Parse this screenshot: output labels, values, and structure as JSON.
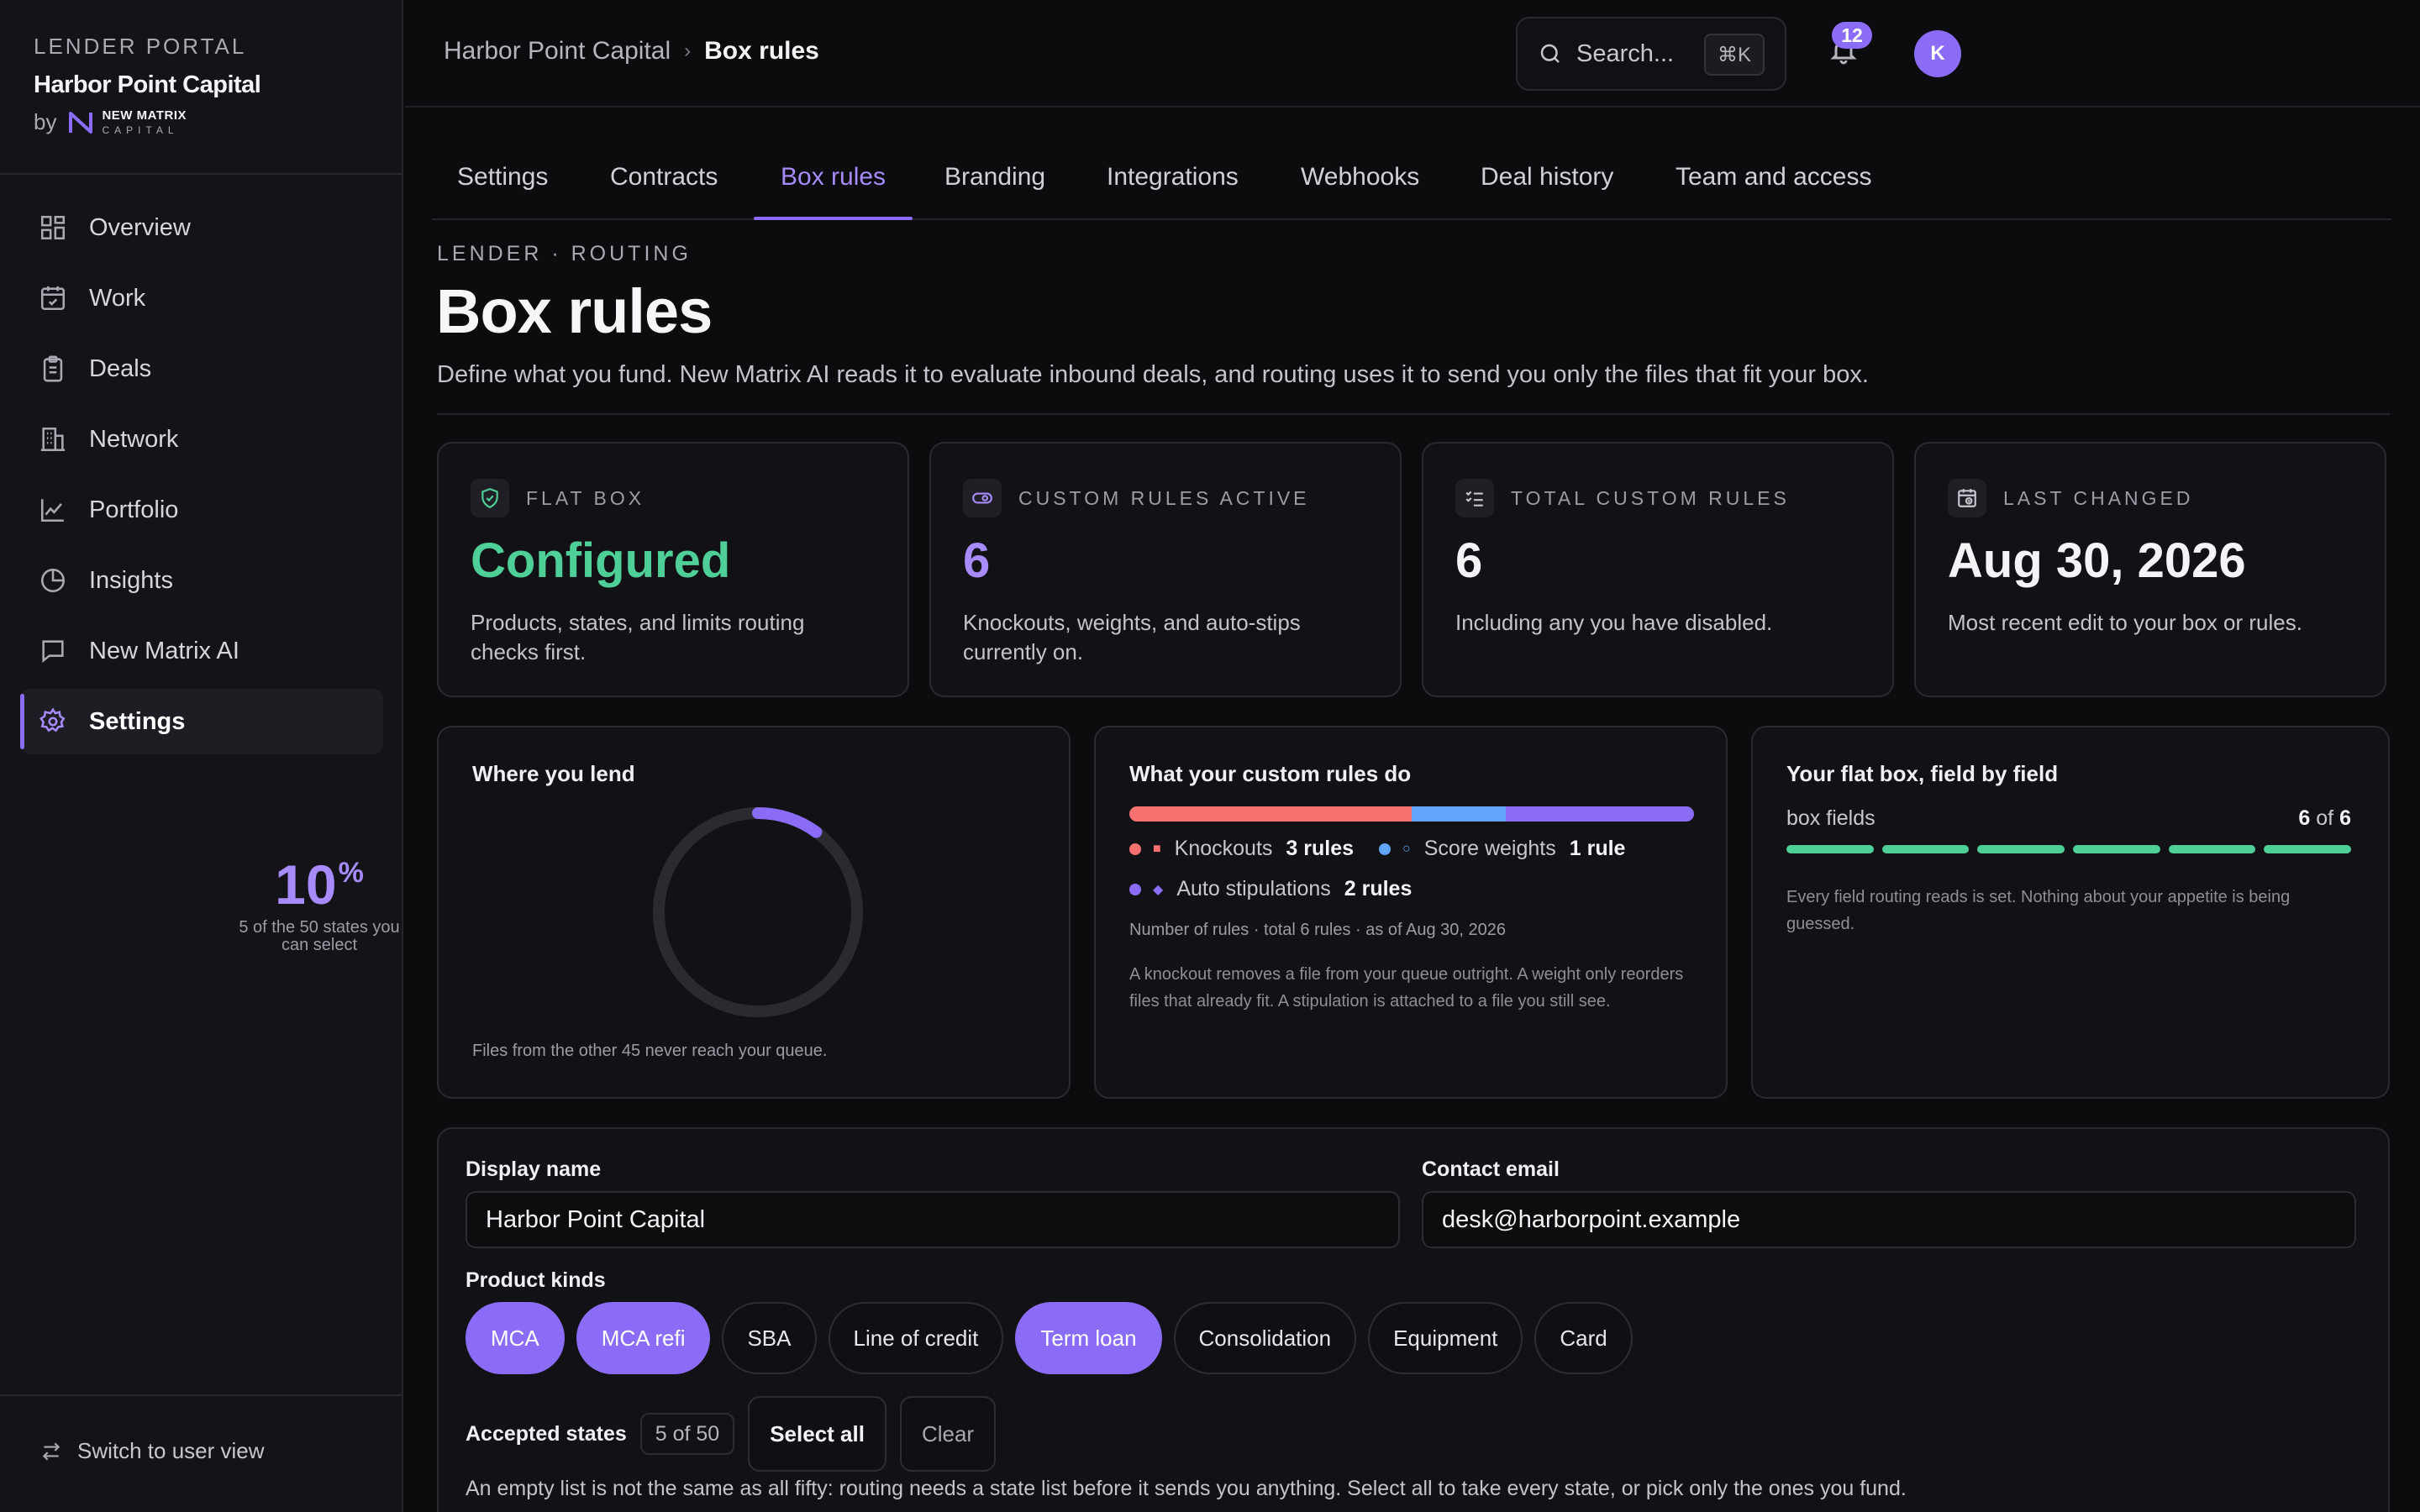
{
  "sidebar": {
    "eyebrow": "LENDER PORTAL",
    "org_name": "Harbor Point Capital",
    "by": "by",
    "logo_line1": "NEW MATRIX",
    "logo_line2": "CAPITAL",
    "items": [
      {
        "label": "Overview",
        "icon": "grid-icon"
      },
      {
        "label": "Work",
        "icon": "calendar-check-icon"
      },
      {
        "label": "Deals",
        "icon": "clipboard-icon"
      },
      {
        "label": "Network",
        "icon": "building-icon"
      },
      {
        "label": "Portfolio",
        "icon": "line-chart-icon"
      },
      {
        "label": "Insights",
        "icon": "pie-chart-icon"
      },
      {
        "label": "New Matrix AI",
        "icon": "chat-icon"
      },
      {
        "label": "Settings",
        "icon": "gear-icon",
        "active": true
      }
    ],
    "switch_view": "Switch to user view"
  },
  "topbar": {
    "breadcrumb_parent": "Harbor Point Capital",
    "breadcrumb_current": "Box rules",
    "search_placeholder": "Search...",
    "search_shortcut": "⌘K",
    "notification_count": "12",
    "avatar_initial": "K"
  },
  "tabs": [
    {
      "label": "Settings"
    },
    {
      "label": "Contracts"
    },
    {
      "label": "Box rules",
      "active": true
    },
    {
      "label": "Branding"
    },
    {
      "label": "Integrations"
    },
    {
      "label": "Webhooks"
    },
    {
      "label": "Deal history"
    },
    {
      "label": "Team and access"
    }
  ],
  "header": {
    "eyebrow": "LENDER · ROUTING",
    "title": "Box rules",
    "description": "Define what you fund. New Matrix AI reads it to evaluate inbound deals, and routing uses it to send you only the files that fit your box."
  },
  "stats": [
    {
      "label": "FLAT BOX",
      "value": "Configured",
      "sub": "Products, states, and limits routing checks first.",
      "accent": "#4fcf98"
    },
    {
      "label": "CUSTOM RULES ACTIVE",
      "value": "6",
      "sub": "Knockouts, weights, and auto-stips currently on.",
      "accent": "#a78bfa"
    },
    {
      "label": "TOTAL CUSTOM RULES",
      "value": "6",
      "sub": "Including any you have disabled.",
      "accent": "#f4f4f7"
    },
    {
      "label": "LAST CHANGED",
      "value": "Aug 30, 2026",
      "sub": "Most recent edit to your box or rules.",
      "accent": "#f4f4f7"
    }
  ],
  "where_you_lend": {
    "title": "Where you lend",
    "percent": "10",
    "percent_sign": "%",
    "fraction": 0.1,
    "note": "5 of the 50 states you can select",
    "footer": "Files from the other 45 never reach your queue."
  },
  "chart_data": {
    "type": "bar",
    "title": "What your custom rules do",
    "series": [
      {
        "name": "Knockouts",
        "value": 3,
        "count_label": "3 rules",
        "glyph": "■",
        "color": "#f87171"
      },
      {
        "name": "Score weights",
        "value": 1,
        "count_label": "1 rule",
        "glyph": "○",
        "color": "#60a5fa"
      },
      {
        "name": "Auto stipulations",
        "value": 2,
        "count_label": "2 rules",
        "glyph": "◆",
        "color": "#8b6cf6"
      }
    ],
    "meta": "Number of rules · total 6 rules · as of Aug 30, 2026",
    "note": "A knockout removes a file from your queue outright. A weight only reorders files that already fit. A stipulation is attached to a file you still see."
  },
  "flat_box": {
    "title": "Your flat box, field by field",
    "label": "box fields",
    "filled": "6",
    "of": "of",
    "total": "6",
    "segments_filled": 6,
    "segments_total": 6,
    "note": "Every field routing reads is set. Nothing about your appetite is being guessed."
  },
  "form": {
    "display_name_label": "Display name",
    "display_name_value": "Harbor Point Capital",
    "contact_email_label": "Contact email",
    "contact_email_value": "desk@harborpoint.example",
    "product_kinds_label": "Product kinds",
    "products": [
      {
        "label": "MCA",
        "selected": true
      },
      {
        "label": "MCA refi",
        "selected": true
      },
      {
        "label": "SBA",
        "selected": false
      },
      {
        "label": "Line of credit",
        "selected": false
      },
      {
        "label": "Term loan",
        "selected": true
      },
      {
        "label": "Consolidation",
        "selected": false
      },
      {
        "label": "Equipment",
        "selected": false
      },
      {
        "label": "Card",
        "selected": false
      }
    ],
    "accepted_states_label": "Accepted states",
    "accepted_states_count": "5 of 50",
    "select_all": "Select all",
    "clear": "Clear",
    "states_note": "An empty list is not the same as all fifty: routing needs a state list before it sends you anything. Select all to take every state, or pick only the ones you fund."
  }
}
